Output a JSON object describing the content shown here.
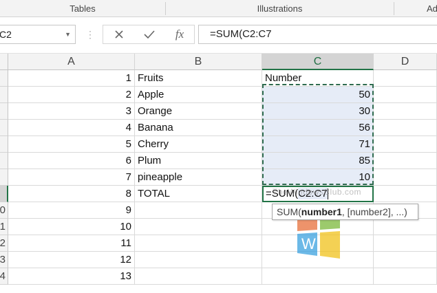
{
  "ribbon": {
    "groups": [
      "Tables",
      "Illustrations",
      "Ad"
    ]
  },
  "formula_bar": {
    "name_box": "C2",
    "formula": "=SUM(C2:C7",
    "cancel_icon": "close-icon",
    "enter_icon": "check-icon",
    "function_icon": "fx",
    "function_label": "fx"
  },
  "columns": [
    "A",
    "B",
    "C",
    "D"
  ],
  "partial_rows": [
    "0",
    "1",
    "2",
    "3",
    "4"
  ],
  "rows": [
    {
      "a": "1",
      "b": "Fruits",
      "c": "Number"
    },
    {
      "a": "2",
      "b": "Apple",
      "c": "50"
    },
    {
      "a": "3",
      "b": "Orange",
      "c": "30"
    },
    {
      "a": "4",
      "b": "Banana",
      "c": "56"
    },
    {
      "a": "5",
      "b": "Cherry",
      "c": "71"
    },
    {
      "a": "6",
      "b": "Plum",
      "c": "85"
    },
    {
      "a": "7",
      "b": "pineapple",
      "c": "10"
    },
    {
      "a": "8",
      "b": "TOTAL",
      "c": ""
    },
    {
      "a": "9",
      "b": "",
      "c": ""
    },
    {
      "a": "10",
      "b": "",
      "c": ""
    },
    {
      "a": "11",
      "b": "",
      "c": ""
    },
    {
      "a": "12",
      "b": "",
      "c": ""
    },
    {
      "a": "13",
      "b": "",
      "c": ""
    }
  ],
  "edit_cell": {
    "prefix": "=SUM(",
    "ref": "C2:C7"
  },
  "tooltip": {
    "func": "SUM(",
    "arg1": "number1",
    "rest": ", [number2], ...)"
  },
  "watermark": "TheWindowsClub.com",
  "colors": {
    "selection_green": "#217346",
    "range_fill": "#e6ecf7"
  }
}
